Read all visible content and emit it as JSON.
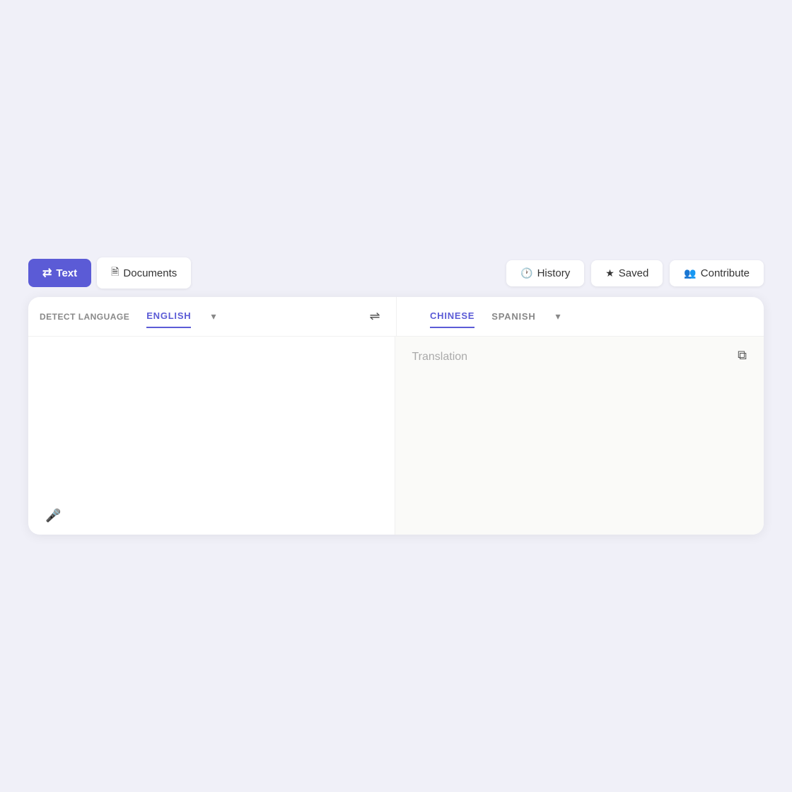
{
  "page": {
    "background": "#f0f0f8"
  },
  "nav": {
    "text_label": "Text",
    "documents_label": "Documents",
    "history_label": "History",
    "saved_label": "Saved",
    "contribute_label": "Contribute"
  },
  "lang_bar": {
    "detect_label": "DETECT LANGUAGE",
    "source_lang": "ENGLISH",
    "swap_icon": "⇄",
    "target_lang_1": "CHINESE",
    "target_lang_2": "SPANISH"
  },
  "panels": {
    "input_placeholder": "",
    "translation_placeholder": "Translation"
  }
}
